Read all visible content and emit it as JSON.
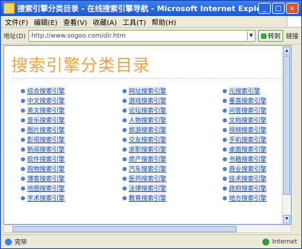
{
  "window": {
    "title": "搜索引擎分类目录 - 在线搜索引擎导航 - Microsoft Internet Explorer",
    "controls": [
      "_",
      "□",
      "×"
    ]
  },
  "menu": [
    "文件(F)",
    "编辑(E)",
    "查看(V)",
    "收藏(A)",
    "工具(T)",
    "帮助(H)"
  ],
  "toolbar": {
    "address_label": "地址(D)",
    "address_value": "http://www.sogoo.com/dir.htm",
    "go_label": "转到",
    "links_label": "链接"
  },
  "page": {
    "title": "搜索引擎分类目录",
    "columns": [
      [
        "综合搜索引擎",
        "中文搜索引擎",
        "英文搜索引擎",
        "音乐搜索引擎",
        "图片搜索引擎",
        "影视搜索引擎",
        "新闻搜索引擎",
        "软件搜索引擎",
        "购物搜索引擎",
        "博客搜索引擎",
        "地图搜索引擎",
        "学术搜索引擎"
      ],
      [
        "网址搜索引擎",
        "游戏搜索引擎",
        "论坛搜索引擎",
        "人物搜索引擎",
        "旅游搜索引擎",
        "交友搜索引擎",
        "求职搜索引擎",
        "房产搜索引擎",
        "汽车搜索引擎",
        "医药搜索引擎",
        "法律搜索引擎",
        "教育搜索引擎"
      ],
      [
        "元搜索引擎",
        "垂直搜索引擎",
        "问答搜索引擎",
        "文档搜索引擎",
        "视频搜索引擎",
        "手机搜索引擎",
        "桌面搜索引擎",
        "书籍搜索引擎",
        "商业搜索引擎",
        "技术搜索引擎",
        "政府搜索引擎",
        "地方搜索引擎"
      ]
    ]
  },
  "status": {
    "text": "完毕",
    "zone": "Internet"
  },
  "colors": {
    "title_orange": "#f0a248",
    "link_blue": "#1f4fb0",
    "xp_blue": "#1b56d8"
  }
}
